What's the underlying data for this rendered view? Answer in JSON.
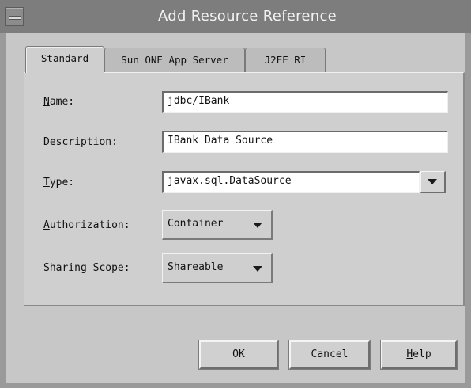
{
  "window": {
    "title": "Add Resource Reference"
  },
  "tabs": [
    {
      "label": "Standard",
      "active": true
    },
    {
      "label": "Sun ONE App Server",
      "active": false
    },
    {
      "label": "J2EE RI",
      "active": false
    }
  ],
  "form": {
    "name": {
      "mnemonic": "N",
      "rest": "ame:",
      "value": "jdbc/IBank"
    },
    "description": {
      "mnemonic": "D",
      "rest": "escription:",
      "value": "IBank Data Source"
    },
    "type": {
      "mnemonic": "T",
      "rest": "ype:",
      "value": "javax.sql.DataSource"
    },
    "authorization": {
      "mnemonic": "A",
      "rest": "uthorization:",
      "value": "Container"
    },
    "sharing_scope": {
      "prefix": "S",
      "mnemonic": "h",
      "rest": "aring Scope:",
      "value": "Shareable"
    }
  },
  "buttons": {
    "ok": "OK",
    "cancel": "Cancel",
    "help_mnemonic": "H",
    "help_rest": "elp"
  },
  "icons": {
    "system_menu": "system-menu-icon",
    "dropdown": "chevron-down-icon"
  },
  "colors": {
    "titlebar": "#7d7d7d",
    "dialog_background": "#c7c7c7",
    "panel_background": "#cfcfcf",
    "field_background": "#ffffff"
  }
}
